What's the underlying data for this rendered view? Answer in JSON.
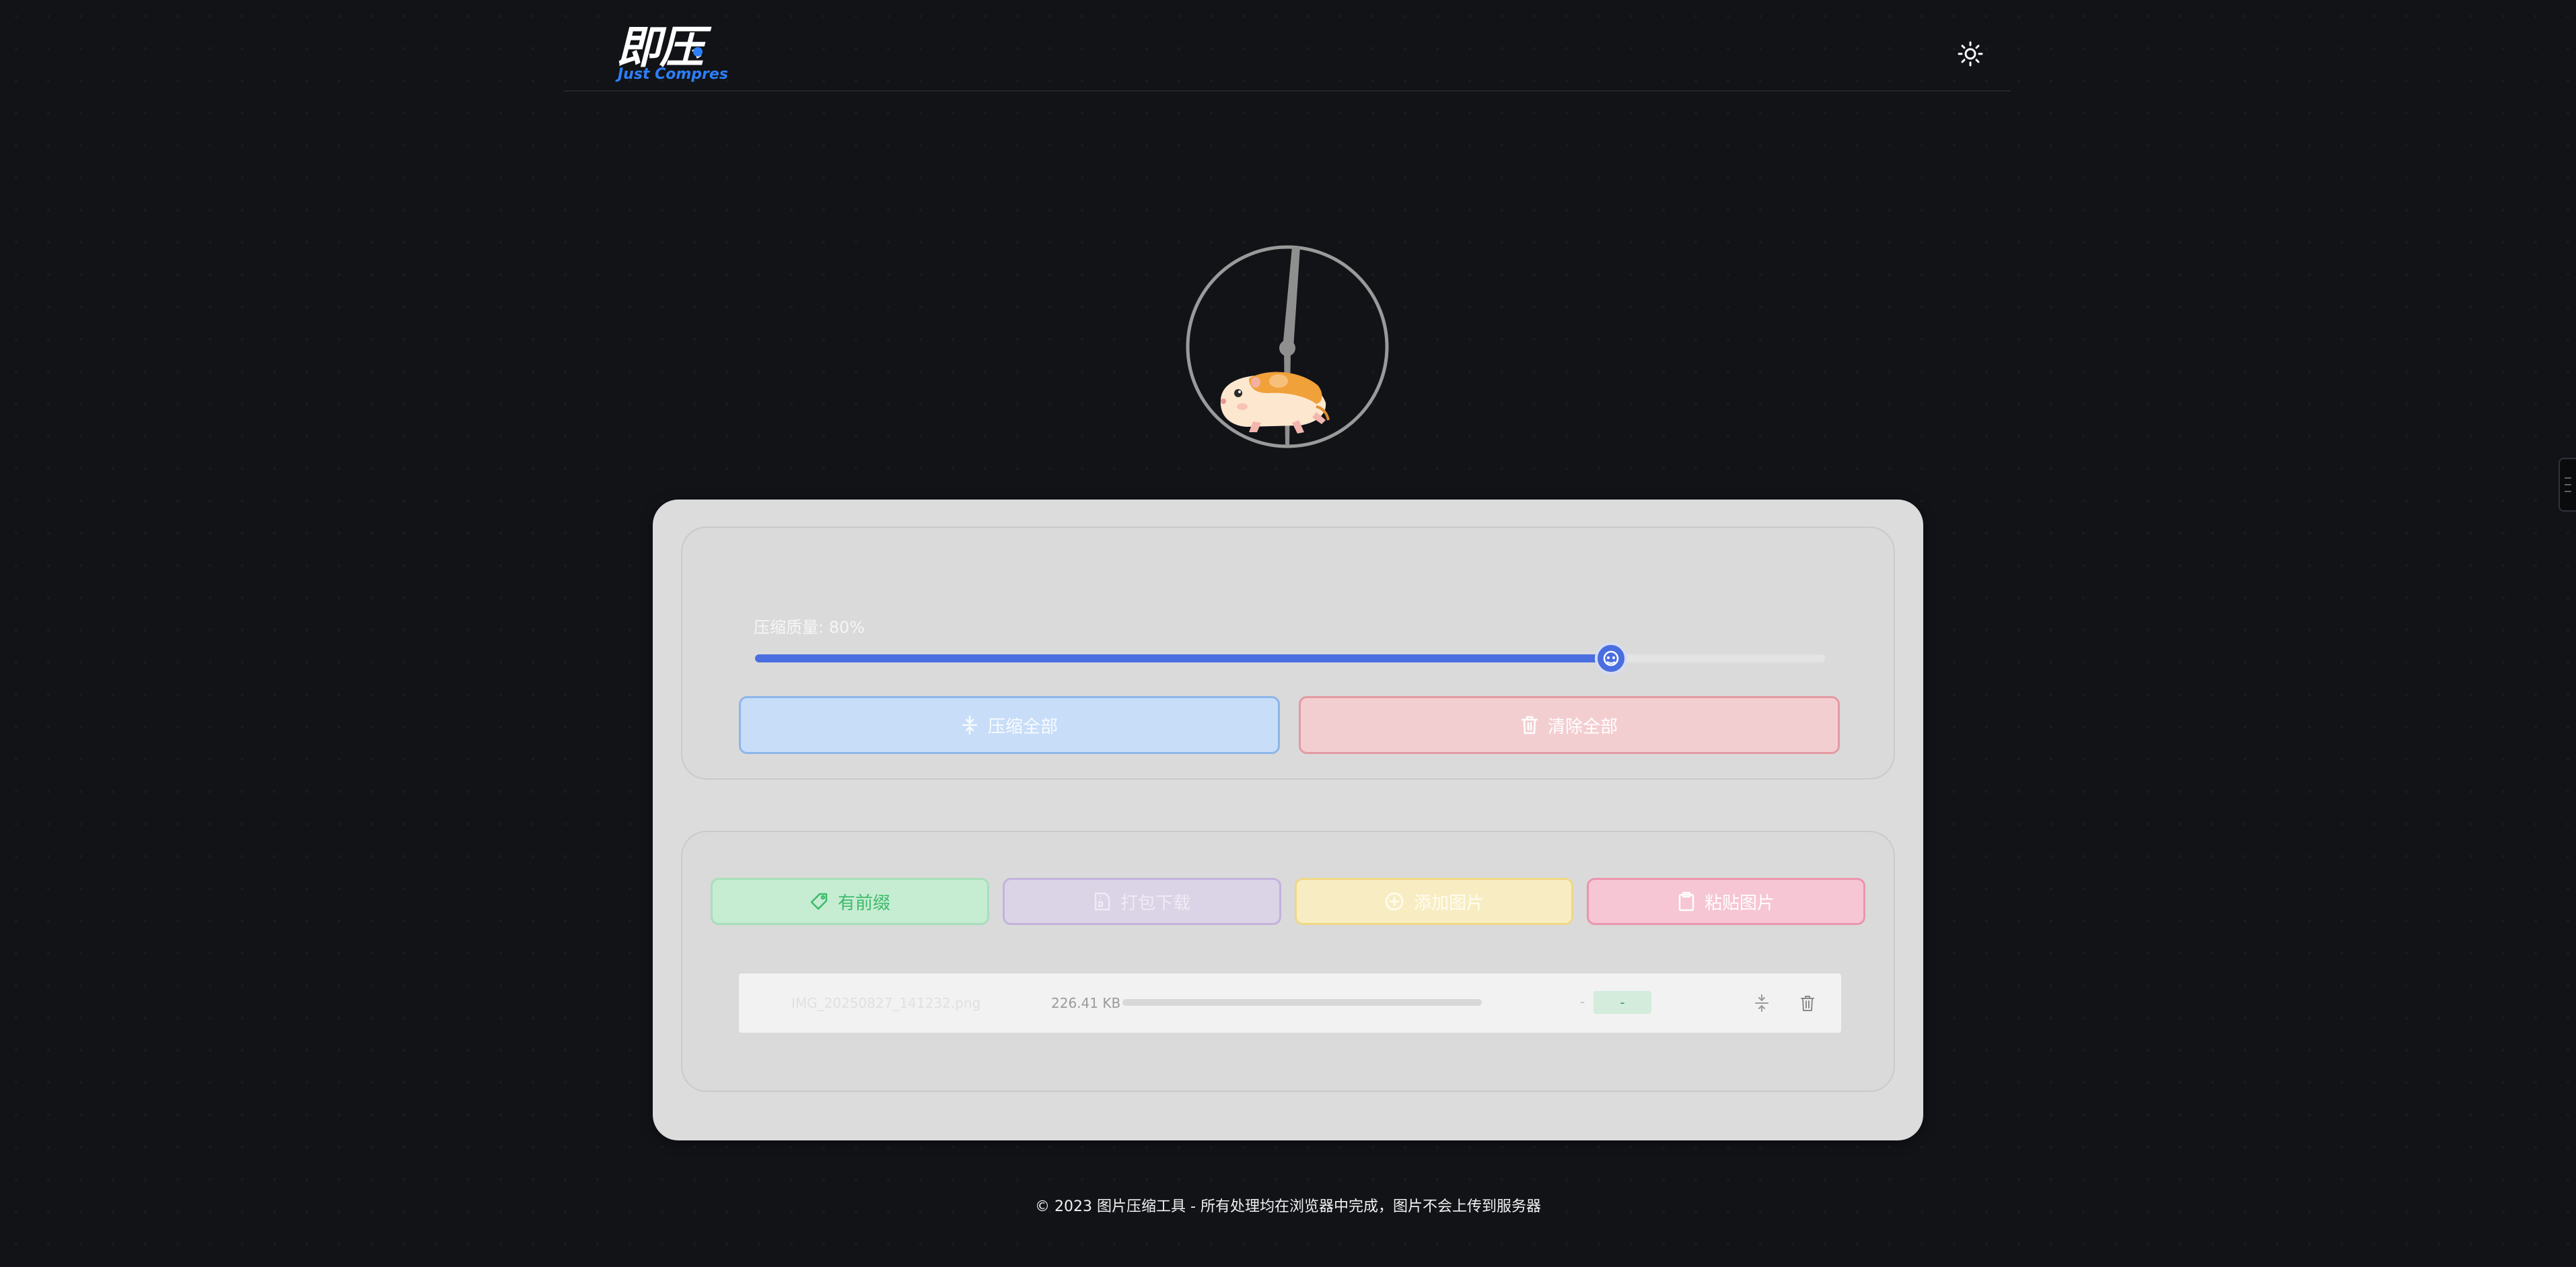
{
  "header": {
    "logo_cn": "即压",
    "logo_en": "Just Compres",
    "theme_toggle_icon": "sun-icon"
  },
  "hero": {
    "illustration": "hamster-wheel-illustration"
  },
  "controls": {
    "quality_label": "压缩质量: 80%",
    "quality_value": 80,
    "compress_all_label": "压缩全部",
    "clear_all_label": "清除全部"
  },
  "toolbar": {
    "prefix_label": "有前缀",
    "download_label": "打包下载",
    "add_label": "添加图片",
    "paste_label": "粘贴图片"
  },
  "files": [
    {
      "name": "IMG_20250827_141232.png",
      "size": "226.41 KB",
      "progress": 0,
      "result_dash": "-",
      "result_badge": "-"
    }
  ],
  "footer": {
    "text": "© 2023 图片压缩工具 - 所有处理均在浏览器中完成，图片不会上传到服务器"
  },
  "colors": {
    "accent": "#4a6ee0",
    "logo_blue": "#2d7ff9",
    "background": "#111317",
    "card": "#dcdcdc"
  }
}
